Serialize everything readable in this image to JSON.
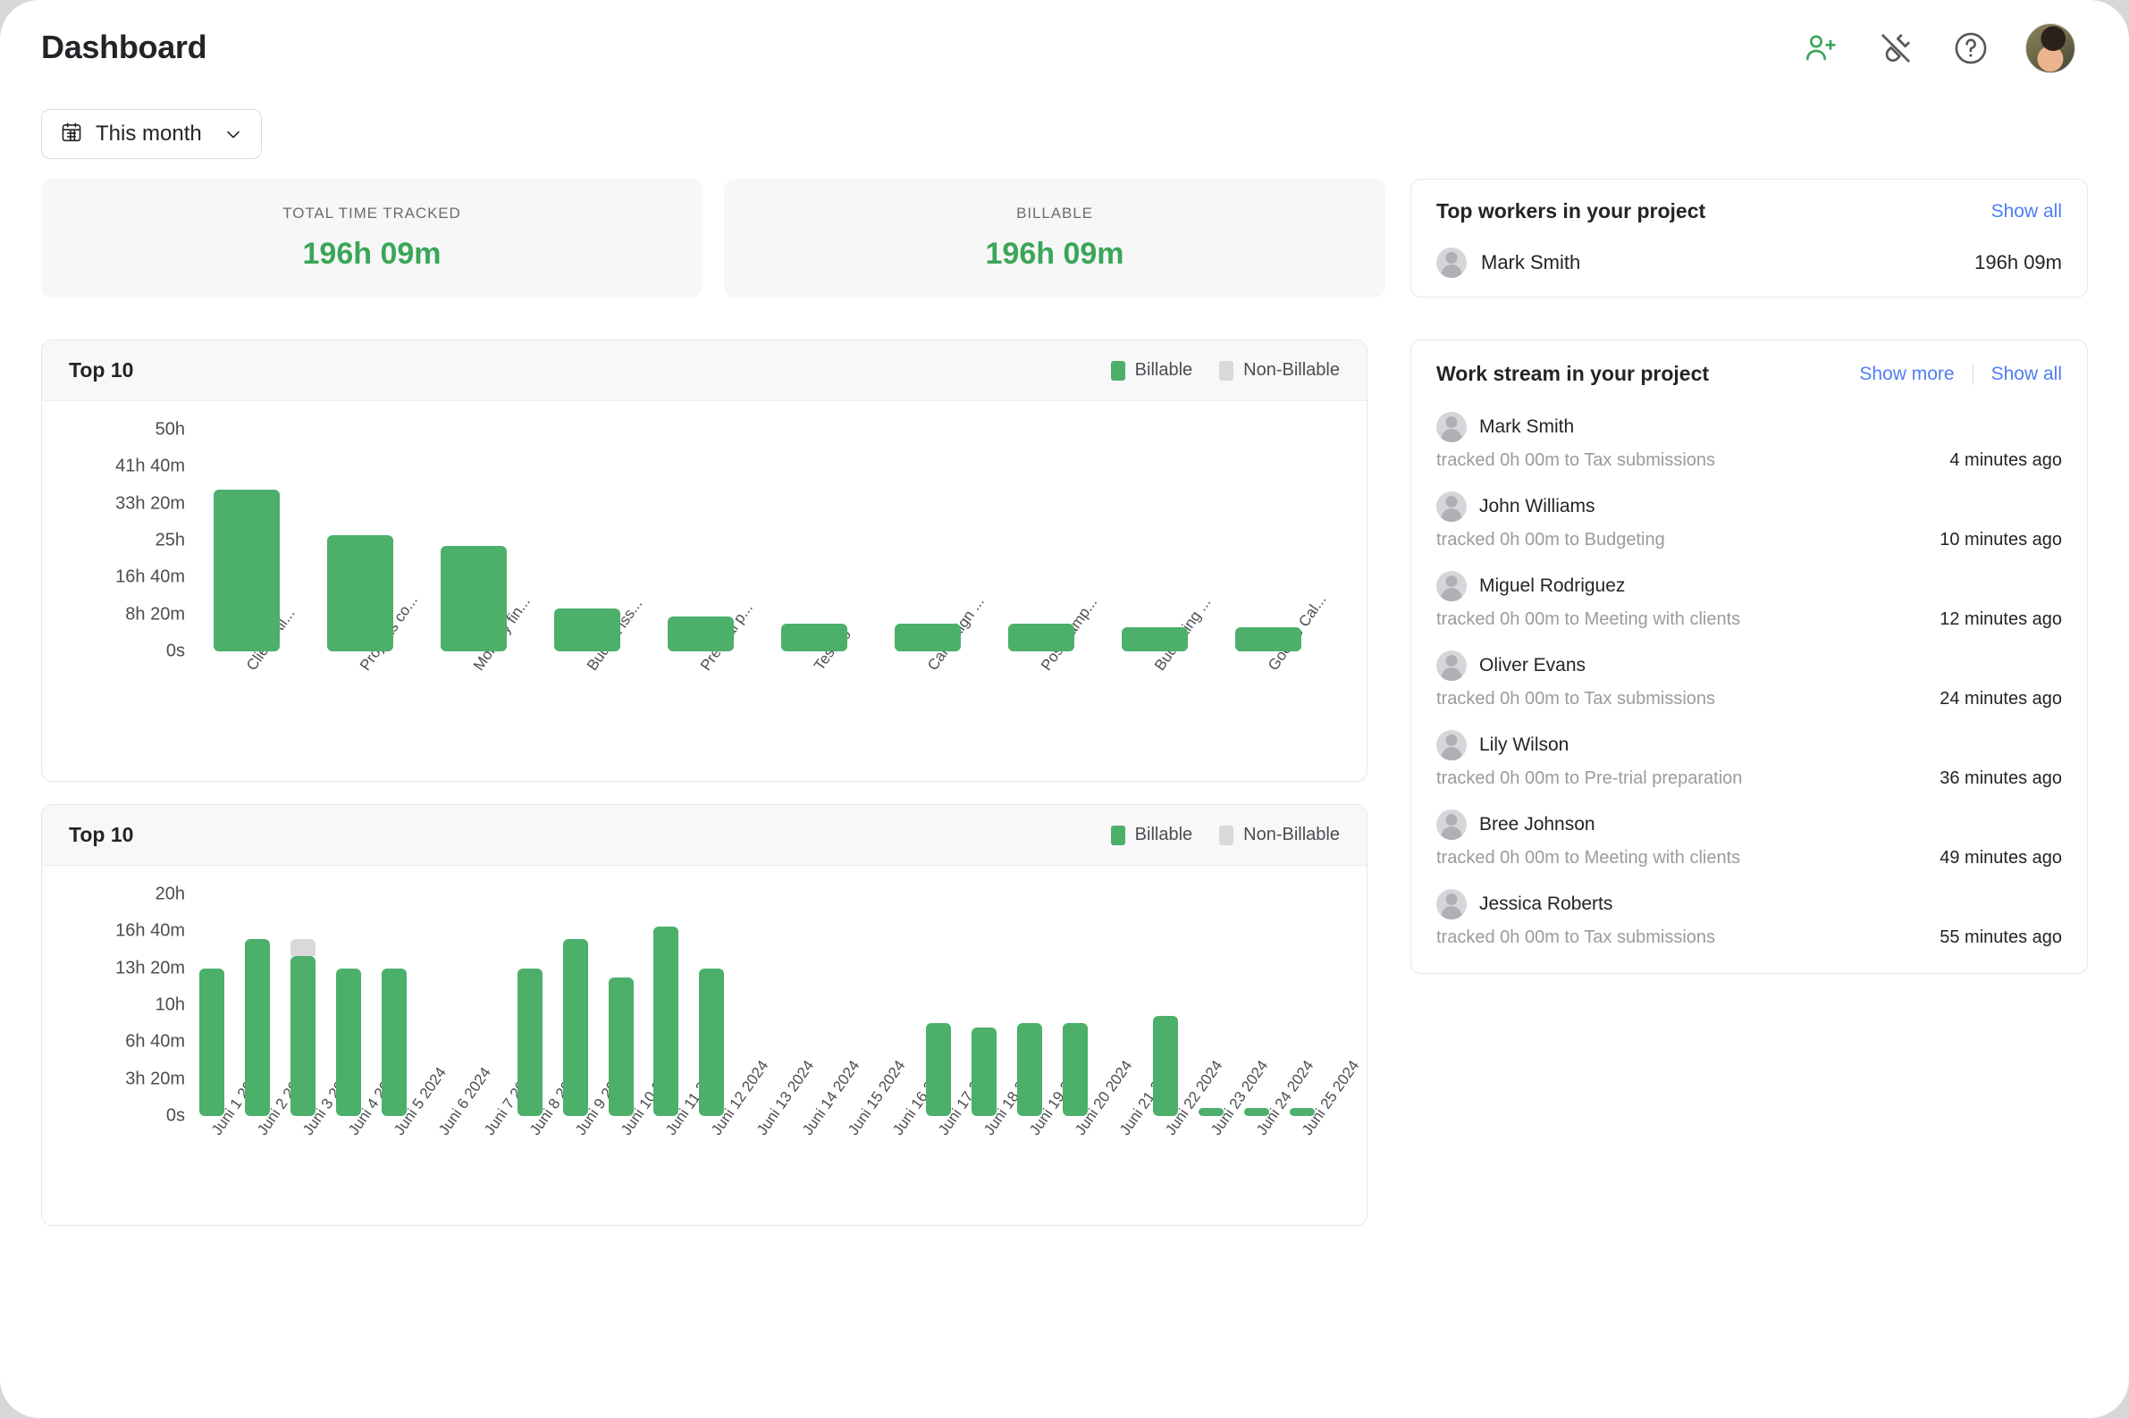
{
  "header": {
    "title": "Dashboard",
    "icons": [
      {
        "name": "add-user-icon",
        "glyph": "user-plus"
      },
      {
        "name": "integrations-plug-icon",
        "glyph": "plug-off"
      },
      {
        "name": "help-icon",
        "glyph": "question-circle"
      },
      {
        "name": "user-avatar",
        "glyph": "avatar"
      }
    ]
  },
  "date_filter": {
    "icon": "calendar-icon",
    "label": "This month",
    "chevron": "chevron-down-icon"
  },
  "stats": [
    {
      "label": "TOTAL TIME TRACKED",
      "value": "196h 09m"
    },
    {
      "label": "BILLABLE",
      "value": "196h 09m"
    }
  ],
  "top_workers": {
    "title": "Top workers in your project",
    "show_all": "Show all",
    "rows": [
      {
        "name": "Mark Smith",
        "time": "196h 09m"
      }
    ]
  },
  "work_stream": {
    "title": "Work stream in your project",
    "show_more": "Show more",
    "show_all": "Show all",
    "items": [
      {
        "name": "Mark Smith",
        "desc": "tracked 0h 00m to Tax submissions",
        "ago": "4 minutes ago"
      },
      {
        "name": "John Williams",
        "desc": "tracked 0h 00m to Budgeting",
        "ago": "10 minutes ago"
      },
      {
        "name": "Miguel Rodriguez",
        "desc": "tracked 0h 00m to Meeting with clients",
        "ago": "12 minutes ago"
      },
      {
        "name": "Oliver Evans",
        "desc": "tracked 0h 00m to Tax submissions",
        "ago": "24 minutes ago"
      },
      {
        "name": "Lily Wilson",
        "desc": "tracked 0h 00m to Pre-trial preparation",
        "ago": "36 minutes ago"
      },
      {
        "name": "Bree Johnson",
        "desc": "tracked 0h 00m to Meeting with clients",
        "ago": "49 minutes ago"
      },
      {
        "name": "Jessica Roberts",
        "desc": "tracked 0h 00m to Tax submissions",
        "ago": "55 minutes ago"
      }
    ]
  },
  "colors": {
    "billable": "#4caf6a",
    "non_billable": "#d9d9db",
    "accent_green": "#3aa657",
    "link_blue": "#4f7df3"
  },
  "chart_data": [
    {
      "id": "projects-top10",
      "type": "bar",
      "title": "Top 10",
      "stacked": true,
      "legend": [
        {
          "label": "Billable",
          "color": "#4caf6a"
        },
        {
          "label": "Non-Billable",
          "color": "#d9d9db"
        }
      ],
      "legend_position": "top-right",
      "grid": false,
      "xlabel": "",
      "ylabel": "",
      "ylim": [
        0,
        50
      ],
      "ytick_labels": [
        "50h",
        "41h 40m",
        "33h 20m",
        "25h",
        "16h 40m",
        "8h 20m",
        "0s"
      ],
      "ytick_values": [
        50,
        41.667,
        33.333,
        25,
        16.667,
        8.333,
        0
      ],
      "categories": [
        "Client All...",
        "Projects co...",
        "Monthly fin...",
        "Budget iss...",
        "Pre-trial p...",
        "Testing",
        "Campaign ...",
        "Post-camp...",
        "Budgeting ...",
        "Google Cal..."
      ],
      "series": [
        {
          "name": "Billable",
          "values": [
            36.5,
            26.3,
            23.7,
            9.6,
            7.9,
            6.2,
            6.2,
            6.2,
            5.4,
            5.4
          ]
        },
        {
          "name": "Non-Billable",
          "values": [
            0,
            0,
            0,
            0,
            0,
            0,
            0,
            0,
            0,
            0
          ]
        }
      ]
    },
    {
      "id": "daily-top10",
      "type": "bar",
      "title": "Top 10",
      "stacked": true,
      "legend": [
        {
          "label": "Billable",
          "color": "#4caf6a"
        },
        {
          "label": "Non-Billable",
          "color": "#d9d9db"
        }
      ],
      "legend_position": "top-right",
      "grid": false,
      "xlabel": "",
      "ylabel": "",
      "ylim": [
        0,
        20
      ],
      "ytick_labels": [
        "20h",
        "16h 40m",
        "13h 20m",
        "10h",
        "6h 40m",
        "3h 20m",
        "0s"
      ],
      "ytick_values": [
        20,
        16.667,
        13.333,
        10,
        6.667,
        3.333,
        0
      ],
      "categories": [
        "Juni 1 2024",
        "Juni 2 2024",
        "Juni 3 2024",
        "Juni 4 2024",
        "Juni 5 2024",
        "Juni 6 2024",
        "Juni 7 2024",
        "Juni 8 2024",
        "Juni 9 2024",
        "Juni 10 2024",
        "Juni 11 2024",
        "Juni 12 2024",
        "Juni 13 2024",
        "Juni 14 2024",
        "Juni 15 2024",
        "Juni 16 2024",
        "Juni 17 2024",
        "Juni 18 2024",
        "Juni 19 2024",
        "Juni 20 2024",
        "Juni 21 2024",
        "Juni 22 2024",
        "Juni 23 2024",
        "Juni 24 2024",
        "Juni 25 2024"
      ],
      "series": [
        {
          "name": "Billable",
          "values": [
            13.3,
            16.0,
            14.4,
            13.3,
            13.3,
            0,
            0,
            13.3,
            16.0,
            12.5,
            17.1,
            13.3,
            0,
            0,
            0,
            0,
            8.4,
            8.0,
            8.4,
            8.4,
            0,
            9.0,
            0.7,
            0.7,
            0.7
          ]
        },
        {
          "name": "Non-Billable",
          "values": [
            0,
            0,
            1.6,
            0,
            0,
            0,
            0,
            0,
            0,
            0,
            0,
            0,
            0,
            0,
            0,
            0,
            0,
            0,
            0,
            0,
            0,
            0,
            0,
            0,
            0
          ]
        }
      ]
    }
  ]
}
